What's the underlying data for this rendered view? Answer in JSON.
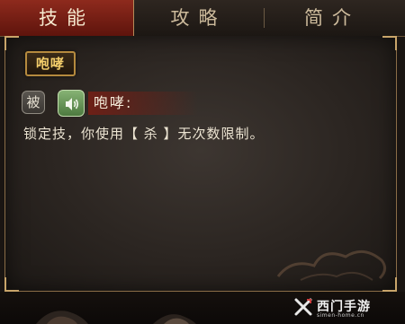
{
  "tabs": [
    {
      "label": "技能",
      "active": true
    },
    {
      "label": "攻略",
      "active": false
    },
    {
      "label": "简介",
      "active": false
    }
  ],
  "skill": {
    "name_button": "咆哮",
    "type_badge": "被",
    "voice_icon": "speaker-icon",
    "title": "咆哮:",
    "description": "锁定技，你使用【 杀 】无次数限制。"
  },
  "watermark": {
    "text": "西门手游",
    "sub": "simen-home.cn"
  },
  "colors": {
    "active_tab": "#8e2a1d",
    "skill_gold": "#f2cc6a",
    "voice_green": "#6a9a5a",
    "panel_border": "#8a6d47"
  }
}
